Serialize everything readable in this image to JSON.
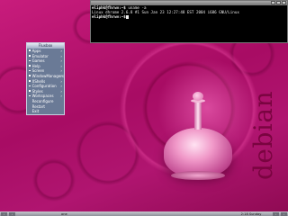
{
  "terminal": {
    "lines": [
      {
        "prompt": "eliphk@fhrwv:~$",
        "command": " uname -a"
      },
      {
        "output": "Linux dhrome 2.6.8 #1 Sun Jan 23 12:27:48 EST 2004 i686 GNU/Linux"
      },
      {
        "prompt": "eliphk@fhrwv:~$",
        "command": ""
      }
    ]
  },
  "root_menu": {
    "title": "Fluxbox",
    "items": [
      {
        "label": "Apps",
        "submenu": true
      },
      {
        "label": "Emulator",
        "submenu": true
      },
      {
        "label": "Games",
        "submenu": true
      },
      {
        "label": "Help",
        "submenu": true
      },
      {
        "label": "Screen",
        "submenu": true
      },
      {
        "label": "WindowManagers",
        "submenu": true
      },
      {
        "label": "XShells",
        "submenu": true
      },
      {
        "label": "Configuration",
        "submenu": true
      },
      {
        "label": "Styles",
        "submenu": true
      },
      {
        "label": "Workspaces",
        "submenu": true
      },
      {
        "label": "Reconfigure",
        "submenu": false
      },
      {
        "label": "Restart",
        "submenu": false
      },
      {
        "label": "Exit",
        "submenu": false
      }
    ]
  },
  "wallpaper": {
    "watermark": "debian"
  },
  "taskbar": {
    "workspace": "one",
    "clock": "2:18 Sunday"
  },
  "colors": {
    "background": "#b8146f",
    "menu_bg": "#6a7a96",
    "terminal_bg": "#000000"
  }
}
